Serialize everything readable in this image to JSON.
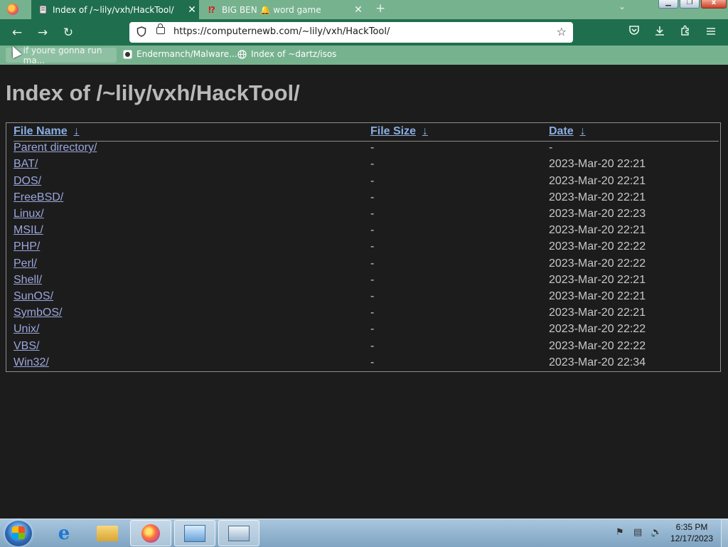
{
  "browser": {
    "tabs": [
      {
        "title": "Index of /~lily/vxh/HackTool/",
        "active": true,
        "favicon": "document-server-icon"
      },
      {
        "title": "BIG BEN 🔔 word game",
        "active": false,
        "favicon": "exclamation-red-icon"
      }
    ],
    "close_glyph": "✕",
    "new_tab_glyph": "+",
    "tab_list_glyph": "⌄",
    "url": "https://computernewb.com/~lily/vxh/HackTool/",
    "bookmarks": [
      {
        "label": "if youre gonna run ma...",
        "icon": "leaf-icon"
      },
      {
        "label": "Endermanch/Malware...",
        "icon": "github-icon"
      },
      {
        "label": "Index of ~dartz/isos",
        "icon": "globe-icon"
      }
    ]
  },
  "page": {
    "title": "Index of /~lily/vxh/HackTool/",
    "headers": {
      "name": "File Name",
      "size": "File Size",
      "date": "Date",
      "sort_glyph": "↓"
    },
    "rows": [
      {
        "name": "Parent directory/",
        "size": "-",
        "date": "-"
      },
      {
        "name": "BAT/",
        "size": "-",
        "date": "2023-Mar-20 22:21"
      },
      {
        "name": "DOS/",
        "size": "-",
        "date": "2023-Mar-20 22:21"
      },
      {
        "name": "FreeBSD/",
        "size": "-",
        "date": "2023-Mar-20 22:21"
      },
      {
        "name": "Linux/",
        "size": "-",
        "date": "2023-Mar-20 22:23"
      },
      {
        "name": "MSIL/",
        "size": "-",
        "date": "2023-Mar-20 22:21"
      },
      {
        "name": "PHP/",
        "size": "-",
        "date": "2023-Mar-20 22:22"
      },
      {
        "name": "Perl/",
        "size": "-",
        "date": "2023-Mar-20 22:22"
      },
      {
        "name": "Shell/",
        "size": "-",
        "date": "2023-Mar-20 22:21"
      },
      {
        "name": "SunOS/",
        "size": "-",
        "date": "2023-Mar-20 22:21"
      },
      {
        "name": "SymbOS/",
        "size": "-",
        "date": "2023-Mar-20 22:21"
      },
      {
        "name": "Unix/",
        "size": "-",
        "date": "2023-Mar-20 22:22"
      },
      {
        "name": "VBS/",
        "size": "-",
        "date": "2023-Mar-20 22:22"
      },
      {
        "name": "Win32/",
        "size": "-",
        "date": "2023-Mar-20 22:34"
      }
    ]
  },
  "taskbar": {
    "time": "6:35 PM",
    "date": "12/17/2023",
    "apps": [
      "internet-explorer-icon",
      "file-explorer-icon",
      "firefox-icon",
      "control-panel-icon",
      "on-screen-keyboard-icon"
    ]
  },
  "colors": {
    "tab_strip": "#77b28f",
    "toolbar": "#1f6f4f",
    "page_bg": "#1c1c1c",
    "link": "#9aa6dc"
  }
}
